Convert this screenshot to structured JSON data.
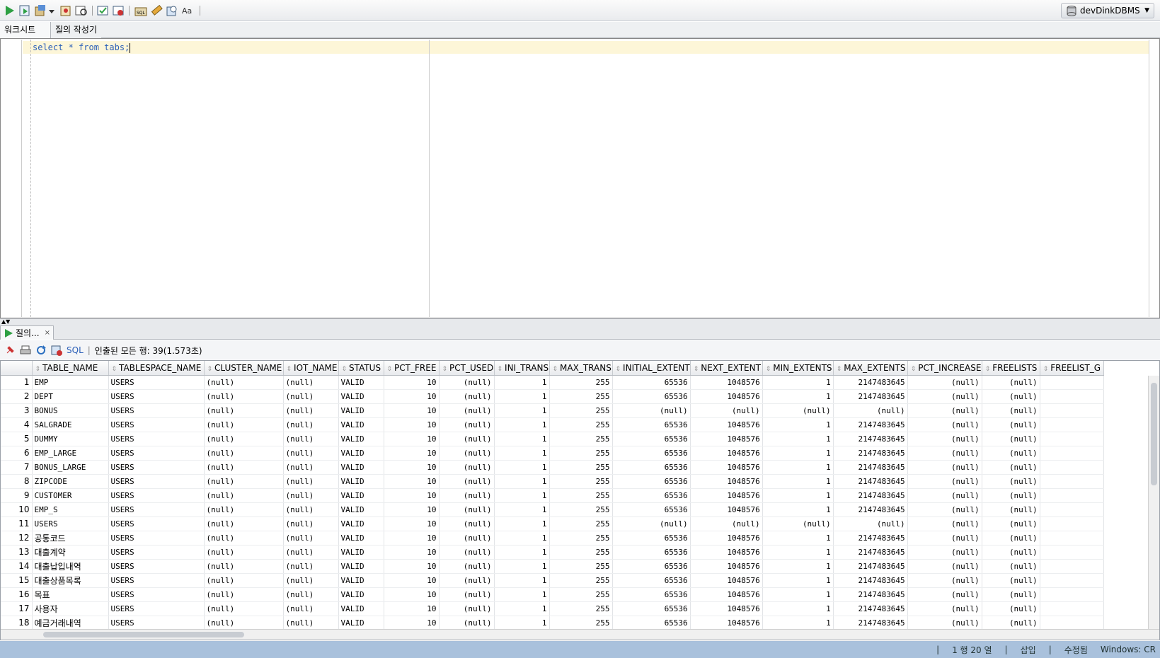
{
  "toolbar": {
    "icons": [
      "run-statement-icon",
      "run-script-icon",
      "commit-icon",
      "dropdown-arrow-icon",
      "rollback-icon",
      "explain-plan-icon",
      "autotrace-icon",
      "sql-tuning-icon",
      "format-icon",
      "eraser-icon",
      "history-icon",
      "case-icon"
    ],
    "connection": "devDinkDBMS"
  },
  "tabs": {
    "worksheet": "워크시트",
    "query_builder": "질의 작성기"
  },
  "editor": {
    "code": "select * from tabs;"
  },
  "results": {
    "tab_label": "질의...",
    "tab_close": "×",
    "sql_label": "SQL",
    "status": "인출된 모든 행: 39(1.573초)",
    "columns": [
      "TABLE_NAME",
      "TABLESPACE_NAME",
      "CLUSTER_NAME",
      "IOT_NAME",
      "STATUS",
      "PCT_FREE",
      "PCT_USED",
      "INI_TRANS",
      "MAX_TRANS",
      "INITIAL_EXTENT",
      "NEXT_EXTENT",
      "MIN_EXTENTS",
      "MAX_EXTENTS",
      "PCT_INCREASE",
      "FREELISTS",
      "FREELIST_G"
    ],
    "rows": [
      [
        "1",
        "EMP",
        "USERS",
        "(null)",
        "(null)",
        "VALID",
        "10",
        "(null)",
        "1",
        "255",
        "65536",
        "1048576",
        "1",
        "2147483645",
        "(null)",
        "(null)"
      ],
      [
        "2",
        "DEPT",
        "USERS",
        "(null)",
        "(null)",
        "VALID",
        "10",
        "(null)",
        "1",
        "255",
        "65536",
        "1048576",
        "1",
        "2147483645",
        "(null)",
        "(null)"
      ],
      [
        "3",
        "BONUS",
        "USERS",
        "(null)",
        "(null)",
        "VALID",
        "10",
        "(null)",
        "1",
        "255",
        "(null)",
        "(null)",
        "(null)",
        "(null)",
        "(null)",
        "(null)"
      ],
      [
        "4",
        "SALGRADE",
        "USERS",
        "(null)",
        "(null)",
        "VALID",
        "10",
        "(null)",
        "1",
        "255",
        "65536",
        "1048576",
        "1",
        "2147483645",
        "(null)",
        "(null)"
      ],
      [
        "5",
        "DUMMY",
        "USERS",
        "(null)",
        "(null)",
        "VALID",
        "10",
        "(null)",
        "1",
        "255",
        "65536",
        "1048576",
        "1",
        "2147483645",
        "(null)",
        "(null)"
      ],
      [
        "6",
        "EMP_LARGE",
        "USERS",
        "(null)",
        "(null)",
        "VALID",
        "10",
        "(null)",
        "1",
        "255",
        "65536",
        "1048576",
        "1",
        "2147483645",
        "(null)",
        "(null)"
      ],
      [
        "7",
        "BONUS_LARGE",
        "USERS",
        "(null)",
        "(null)",
        "VALID",
        "10",
        "(null)",
        "1",
        "255",
        "65536",
        "1048576",
        "1",
        "2147483645",
        "(null)",
        "(null)"
      ],
      [
        "8",
        "ZIPCODE",
        "USERS",
        "(null)",
        "(null)",
        "VALID",
        "10",
        "(null)",
        "1",
        "255",
        "65536",
        "1048576",
        "1",
        "2147483645",
        "(null)",
        "(null)"
      ],
      [
        "9",
        "CUSTOMER",
        "USERS",
        "(null)",
        "(null)",
        "VALID",
        "10",
        "(null)",
        "1",
        "255",
        "65536",
        "1048576",
        "1",
        "2147483645",
        "(null)",
        "(null)"
      ],
      [
        "10",
        "EMP_S",
        "USERS",
        "(null)",
        "(null)",
        "VALID",
        "10",
        "(null)",
        "1",
        "255",
        "65536",
        "1048576",
        "1",
        "2147483645",
        "(null)",
        "(null)"
      ],
      [
        "11",
        "USERS",
        "USERS",
        "(null)",
        "(null)",
        "VALID",
        "10",
        "(null)",
        "1",
        "255",
        "(null)",
        "(null)",
        "(null)",
        "(null)",
        "(null)",
        "(null)"
      ],
      [
        "12",
        "공통코드",
        "USERS",
        "(null)",
        "(null)",
        "VALID",
        "10",
        "(null)",
        "1",
        "255",
        "65536",
        "1048576",
        "1",
        "2147483645",
        "(null)",
        "(null)"
      ],
      [
        "13",
        "대출계약",
        "USERS",
        "(null)",
        "(null)",
        "VALID",
        "10",
        "(null)",
        "1",
        "255",
        "65536",
        "1048576",
        "1",
        "2147483645",
        "(null)",
        "(null)"
      ],
      [
        "14",
        "대출납입내역",
        "USERS",
        "(null)",
        "(null)",
        "VALID",
        "10",
        "(null)",
        "1",
        "255",
        "65536",
        "1048576",
        "1",
        "2147483645",
        "(null)",
        "(null)"
      ],
      [
        "15",
        "대출상품목록",
        "USERS",
        "(null)",
        "(null)",
        "VALID",
        "10",
        "(null)",
        "1",
        "255",
        "65536",
        "1048576",
        "1",
        "2147483645",
        "(null)",
        "(null)"
      ],
      [
        "16",
        "목표",
        "USERS",
        "(null)",
        "(null)",
        "VALID",
        "10",
        "(null)",
        "1",
        "255",
        "65536",
        "1048576",
        "1",
        "2147483645",
        "(null)",
        "(null)"
      ],
      [
        "17",
        "사용자",
        "USERS",
        "(null)",
        "(null)",
        "VALID",
        "10",
        "(null)",
        "1",
        "255",
        "65536",
        "1048576",
        "1",
        "2147483645",
        "(null)",
        "(null)"
      ],
      [
        "18",
        "예금거래내역",
        "USERS",
        "(null)",
        "(null)",
        "VALID",
        "10",
        "(null)",
        "1",
        "255",
        "65536",
        "1048576",
        "1",
        "2147483645",
        "(null)",
        "(null)"
      ]
    ]
  },
  "statusbar": {
    "position": "1 행 20 열",
    "mode": "삽입",
    "state": "수정됨",
    "lineend": "Windows: CR"
  }
}
